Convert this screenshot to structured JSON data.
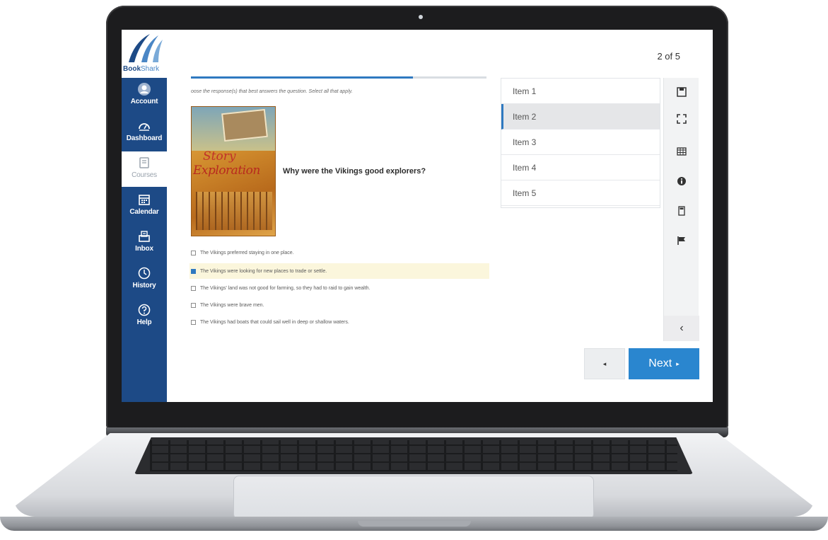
{
  "brand": {
    "logo_main": "Book",
    "logo_thin": "Shark"
  },
  "sidebar": {
    "items": [
      {
        "label": "Account",
        "icon": "account-icon"
      },
      {
        "label": "Dashboard",
        "icon": "dashboard-icon"
      },
      {
        "label": "Courses",
        "icon": "courses-icon",
        "active": true
      },
      {
        "label": "Calendar",
        "icon": "calendar-icon"
      },
      {
        "label": "Inbox",
        "icon": "inbox-icon"
      },
      {
        "label": "History",
        "icon": "history-icon"
      },
      {
        "label": "Help",
        "icon": "help-icon"
      }
    ]
  },
  "header": {
    "page_counter": "2 of 5",
    "progress": 0.75
  },
  "question": {
    "instructions": "oose the response(s) that best answers the question. Select all that apply.",
    "book_title_line1": "Story",
    "book_title_line2": "Exploration",
    "prompt": "Why were the Vikings good explorers?",
    "options": [
      {
        "text": "The Vikings preferred staying in one place.",
        "checked": false
      },
      {
        "text": "The Vikings were looking for new places to trade or settle.",
        "checked": true
      },
      {
        "text": "The Vikings' land was not good for farming, so they had to raid to gain wealth.",
        "checked": false
      },
      {
        "text": "The Vikings were brave men.",
        "checked": false
      },
      {
        "text": "The Vikings had boats that could sail well in deep or shallow waters.",
        "checked": false
      }
    ]
  },
  "item_list": {
    "items": [
      "Item 1",
      "Item 2",
      "Item 3",
      "Item 4",
      "Item 5"
    ],
    "active_index": 1
  },
  "tools": [
    "save-icon",
    "fullscreen-icon",
    "table-icon",
    "info-icon",
    "calculator-icon",
    "flag-icon"
  ],
  "collapse_label": "‹",
  "nav": {
    "prev_label": "◂",
    "next_label": "Next",
    "next_arrow": "▸"
  },
  "colors": {
    "sidebar": "#1d4a86",
    "accent": "#2a86cf",
    "selected_option": "#fbf6dc"
  }
}
